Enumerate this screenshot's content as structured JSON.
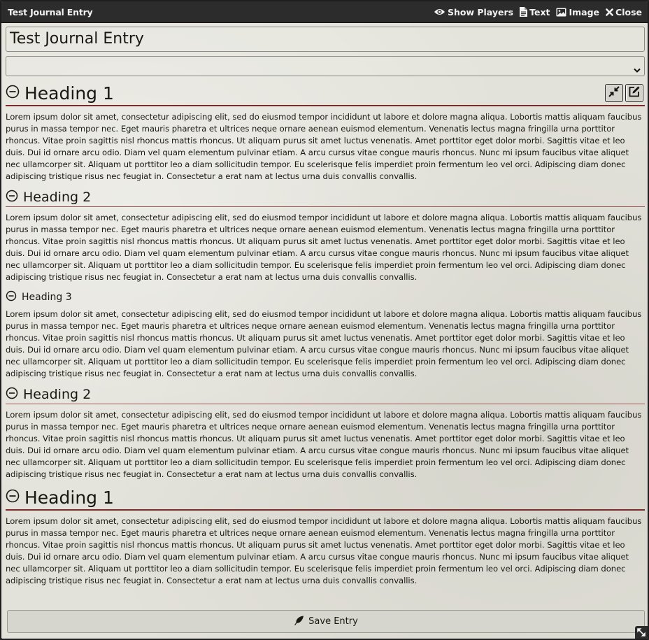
{
  "window": {
    "title": "Test Journal Entry",
    "controls": {
      "show_players": "Show Players",
      "text": "Text",
      "image": "Image",
      "close": "Close"
    }
  },
  "form": {
    "name_value": "Test Journal Entry",
    "folder_value": ""
  },
  "sections": [
    {
      "heading": "Heading 1",
      "body": "Lorem ipsum dolor sit amet, consectetur adipiscing elit, sed do eiusmod tempor incididunt ut labore et dolore magna aliqua. Lobortis mattis aliquam faucibus purus in massa tempor nec. Eget mauris pharetra et ultrices neque ornare aenean euismod elementum. Venenatis lectus magna fringilla urna porttitor rhoncus. Vitae proin sagittis nisl rhoncus mattis rhoncus. Ut aliquam purus sit amet luctus venenatis. Amet porttitor eget dolor morbi. Sagittis vitae et leo duis. Dui id ornare arcu odio. Diam vel quam elementum pulvinar etiam. A arcu cursus vitae congue mauris rhoncus. Nunc mi ipsum faucibus vitae aliquet nec ullamcorper sit. Aliquam ut porttitor leo a diam sollicitudin tempor. Eu scelerisque felis imperdiet proin fermentum leo vel orci. Adipiscing diam donec adipiscing tristique risus nec feugiat in. Consectetur a erat nam at lectus urna duis convallis convallis."
    },
    {
      "heading": "Heading 2",
      "body": "Lorem ipsum dolor sit amet, consectetur adipiscing elit, sed do eiusmod tempor incididunt ut labore et dolore magna aliqua. Lobortis mattis aliquam faucibus purus in massa tempor nec. Eget mauris pharetra et ultrices neque ornare aenean euismod elementum. Venenatis lectus magna fringilla urna porttitor rhoncus. Vitae proin sagittis nisl rhoncus mattis rhoncus. Ut aliquam purus sit amet luctus venenatis. Amet porttitor eget dolor morbi. Sagittis vitae et leo duis. Dui id ornare arcu odio. Diam vel quam elementum pulvinar etiam. A arcu cursus vitae congue mauris rhoncus. Nunc mi ipsum faucibus vitae aliquet nec ullamcorper sit. Aliquam ut porttitor leo a diam sollicitudin tempor. Eu scelerisque felis imperdiet proin fermentum leo vel orci. Adipiscing diam donec adipiscing tristique risus nec feugiat in. Consectetur a erat nam at lectus urna duis convallis convallis."
    },
    {
      "heading": "Heading 3",
      "body": "Lorem ipsum dolor sit amet, consectetur adipiscing elit, sed do eiusmod tempor incididunt ut labore et dolore magna aliqua. Lobortis mattis aliquam faucibus purus in massa tempor nec. Eget mauris pharetra et ultrices neque ornare aenean euismod elementum. Venenatis lectus magna fringilla urna porttitor rhoncus. Vitae proin sagittis nisl rhoncus mattis rhoncus. Ut aliquam purus sit amet luctus venenatis. Amet porttitor eget dolor morbi. Sagittis vitae et leo duis. Dui id ornare arcu odio. Diam vel quam elementum pulvinar etiam. A arcu cursus vitae congue mauris rhoncus. Nunc mi ipsum faucibus vitae aliquet nec ullamcorper sit. Aliquam ut porttitor leo a diam sollicitudin tempor. Eu scelerisque felis imperdiet proin fermentum leo vel orci. Adipiscing diam donec adipiscing tristique risus nec feugiat in. Consectetur a erat nam at lectus urna duis convallis convallis."
    },
    {
      "heading": "Heading 2",
      "body": "Lorem ipsum dolor sit amet, consectetur adipiscing elit, sed do eiusmod tempor incididunt ut labore et dolore magna aliqua. Lobortis mattis aliquam faucibus purus in massa tempor nec. Eget mauris pharetra et ultrices neque ornare aenean euismod elementum. Venenatis lectus magna fringilla urna porttitor rhoncus. Vitae proin sagittis nisl rhoncus mattis rhoncus. Ut aliquam purus sit amet luctus venenatis. Amet porttitor eget dolor morbi. Sagittis vitae et leo duis. Dui id ornare arcu odio. Diam vel quam elementum pulvinar etiam. A arcu cursus vitae congue mauris rhoncus. Nunc mi ipsum faucibus vitae aliquet nec ullamcorper sit. Aliquam ut porttitor leo a diam sollicitudin tempor. Eu scelerisque felis imperdiet proin fermentum leo vel orci. Adipiscing diam donec adipiscing tristique risus nec feugiat in. Consectetur a erat nam at lectus urna duis convallis convallis."
    },
    {
      "heading": "Heading 1",
      "body": "Lorem ipsum dolor sit amet, consectetur adipiscing elit, sed do eiusmod tempor incididunt ut labore et dolore magna aliqua. Lobortis mattis aliquam faucibus purus in massa tempor nec. Eget mauris pharetra et ultrices neque ornare aenean euismod elementum. Venenatis lectus magna fringilla urna porttitor rhoncus. Vitae proin sagittis nisl rhoncus mattis rhoncus. Ut aliquam purus sit amet luctus venenatis. Amet porttitor eget dolor morbi. Sagittis vitae et leo duis. Dui id ornare arcu odio. Diam vel quam elementum pulvinar etiam. A arcu cursus vitae congue mauris rhoncus. Nunc mi ipsum faucibus vitae aliquet nec ullamcorper sit. Aliquam ut porttitor leo a diam sollicitudin tempor. Eu scelerisque felis imperdiet proin fermentum leo vel orci. Adipiscing diam donec adipiscing tristique risus nec feugiat in. Consectetur a erat nam at lectus urna duis convallis convallis."
    }
  ],
  "footer": {
    "save_label": "Save Entry"
  },
  "icons": {
    "show_players": "eye-icon",
    "text": "file-text-icon",
    "image": "image-icon",
    "close": "close-icon",
    "collapse": "minus-circle-icon",
    "compress": "compress-icon",
    "edit": "edit-icon",
    "save": "feather-icon",
    "resize": "resize-icon"
  },
  "colors": {
    "header_bg": "#2c2c2c",
    "parchment": "#e3e2da",
    "heading_rule": "#7a2b2b"
  }
}
